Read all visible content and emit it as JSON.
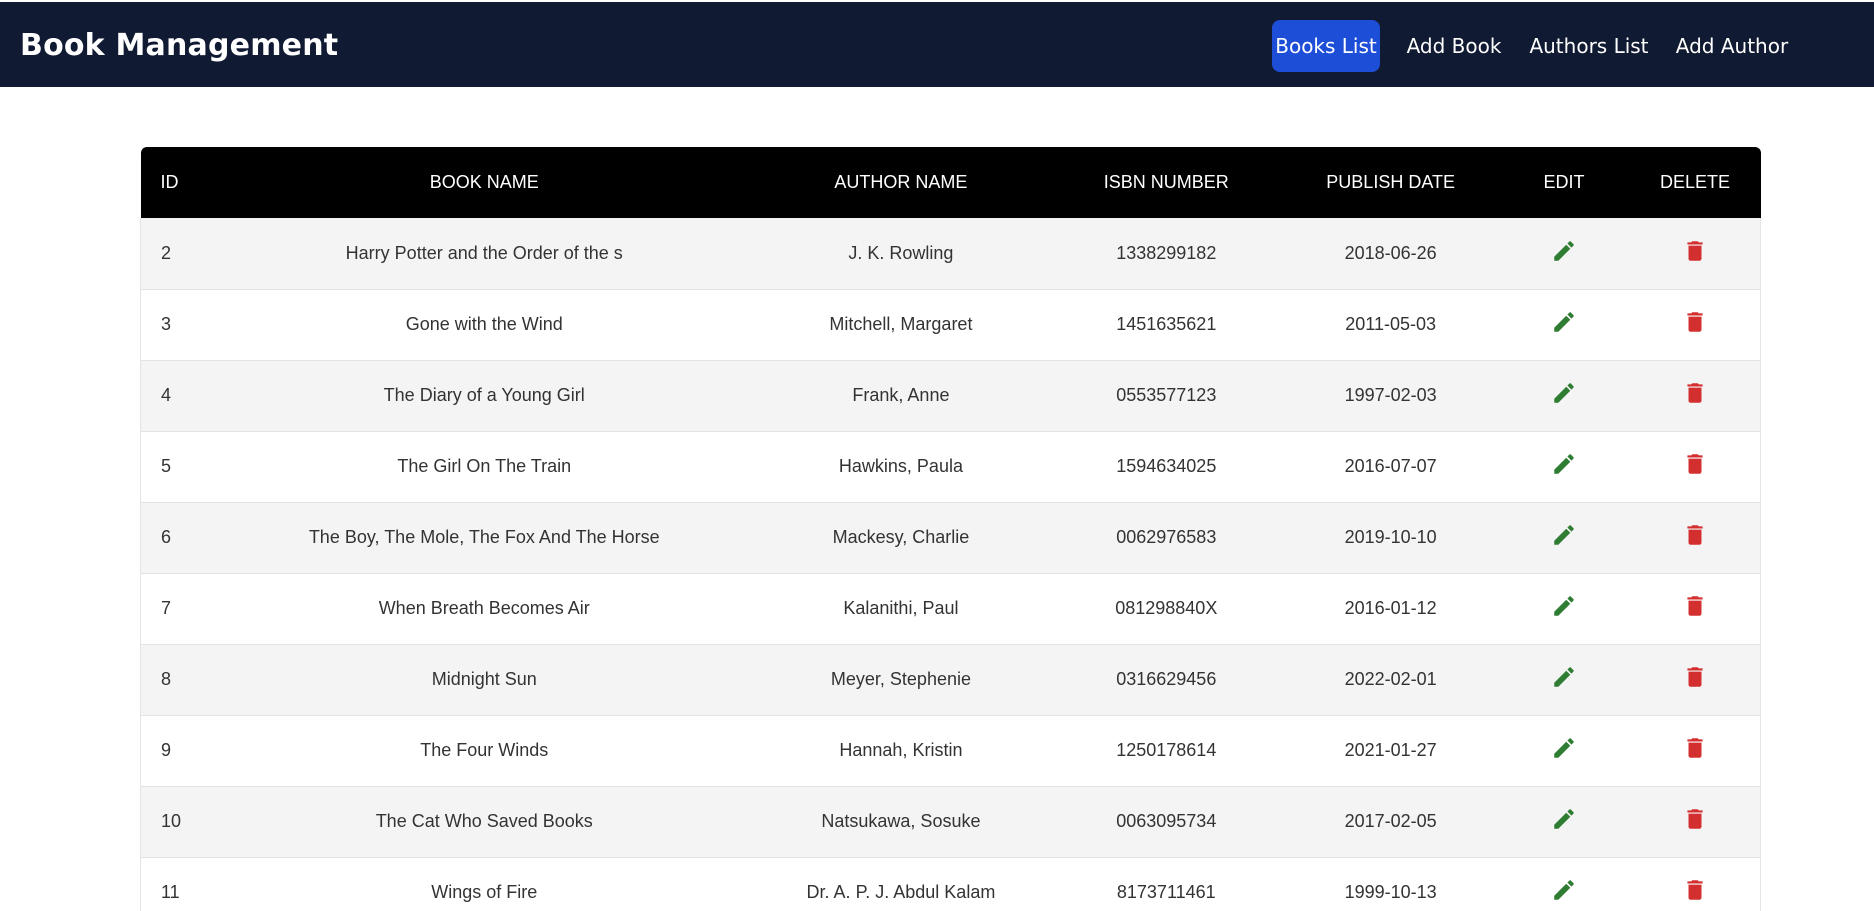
{
  "navbar": {
    "brand": "Book Management",
    "links": [
      {
        "label": "Books List",
        "active": true
      },
      {
        "label": "Add Book",
        "active": false
      },
      {
        "label": "Authors List",
        "active": false
      },
      {
        "label": "Add Author",
        "active": false
      }
    ]
  },
  "table": {
    "headers": [
      "ID",
      "BOOK NAME",
      "AUTHOR NAME",
      "ISBN NUMBER",
      "PUBLISH DATE",
      "EDIT",
      "DELETE"
    ],
    "rows": [
      {
        "id": "2",
        "book": "Harry Potter and the Order of the s",
        "author": "J. K. Rowling",
        "isbn": "1338299182",
        "date": "2018-06-26"
      },
      {
        "id": "3",
        "book": "Gone with the Wind",
        "author": "Mitchell, Margaret",
        "isbn": "1451635621",
        "date": "2011-05-03"
      },
      {
        "id": "4",
        "book": "The Diary of a Young Girl",
        "author": "Frank, Anne",
        "isbn": "0553577123",
        "date": "1997-02-03"
      },
      {
        "id": "5",
        "book": "The Girl On The Train",
        "author": "Hawkins, Paula",
        "isbn": "1594634025",
        "date": "2016-07-07"
      },
      {
        "id": "6",
        "book": "The Boy, The Mole, The Fox And The Horse",
        "author": "Mackesy, Charlie",
        "isbn": "0062976583",
        "date": "2019-10-10"
      },
      {
        "id": "7",
        "book": "When Breath Becomes Air",
        "author": "Kalanithi, Paul",
        "isbn": "081298840X",
        "date": "2016-01-12"
      },
      {
        "id": "8",
        "book": "Midnight Sun",
        "author": "Meyer, Stephenie",
        "isbn": "0316629456",
        "date": "2022-02-01"
      },
      {
        "id": "9",
        "book": "The Four Winds",
        "author": "Hannah, Kristin",
        "isbn": "1250178614",
        "date": "2021-01-27"
      },
      {
        "id": "10",
        "book": "The Cat Who Saved Books",
        "author": "Natsukawa, Sosuke",
        "isbn": "0063095734",
        "date": "2017-02-05"
      },
      {
        "id": "11",
        "book": "Wings of Fire",
        "author": "Dr. A. P. J. Abdul Kalam",
        "isbn": "8173711461",
        "date": "1999-10-13"
      }
    ]
  },
  "icons": {
    "edit": "pencil-icon",
    "delete": "trash-icon"
  },
  "colors": {
    "navbar_bg": "#101a32",
    "active_link_bg": "#1d4ed8",
    "header_bg": "#000000",
    "edit_icon": "#2e7d32",
    "delete_icon": "#d32f2f"
  }
}
